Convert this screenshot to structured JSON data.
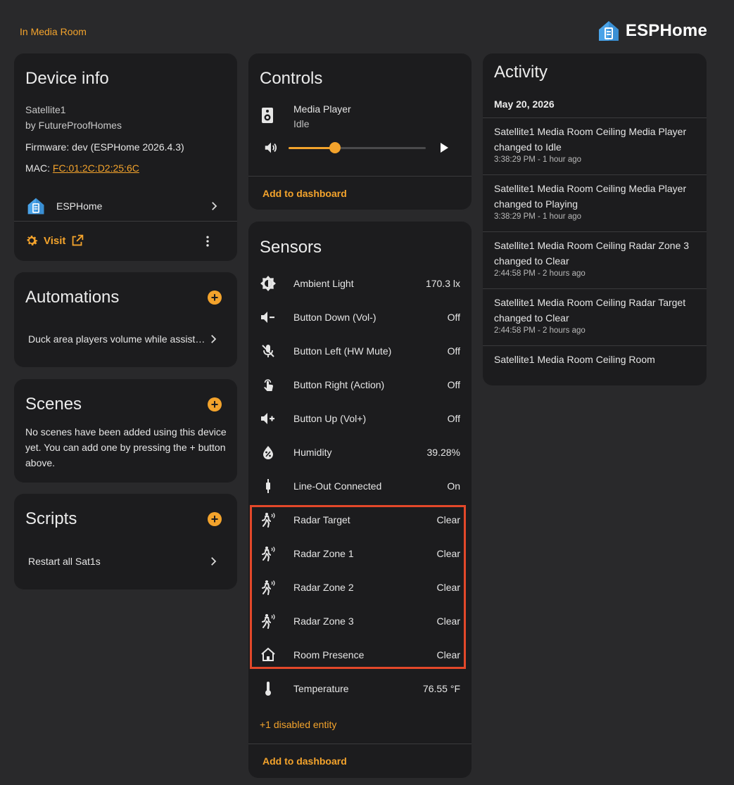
{
  "header": {
    "area_link": "In Media Room",
    "brand_name": "ESPHome"
  },
  "device_info": {
    "title": "Device info",
    "model": "Satellite1",
    "manufacturer": "by FutureProofHomes",
    "firmware": "Firmware: dev (ESPHome 2026.4.3)",
    "mac_label": "MAC: ",
    "mac_value": "FC:01:2C:D2:25:6C",
    "integration": "ESPHome",
    "visit_label": "Visit"
  },
  "automations": {
    "title": "Automations",
    "items": [
      "Duck area players volume while assist is active"
    ]
  },
  "scenes": {
    "title": "Scenes",
    "empty_text": "No scenes have been added using this device yet. You can add one by pressing the + button above."
  },
  "scripts": {
    "title": "Scripts",
    "items": [
      "Restart all Sat1s"
    ]
  },
  "controls": {
    "title": "Controls",
    "media_player": {
      "name": "Media Player",
      "state": "Idle",
      "volume": 0.34
    },
    "add_to_dashboard": "Add to dashboard"
  },
  "sensors": {
    "title": "Sensors",
    "items": [
      {
        "name": "Ambient Light",
        "value": "170.3 lx",
        "icon": "brightness-icon"
      },
      {
        "name": "Button Down (Vol-)",
        "value": "Off",
        "icon": "volume-minus-icon"
      },
      {
        "name": "Button Left (HW Mute)",
        "value": "Off",
        "icon": "mic-off-icon"
      },
      {
        "name": "Button Right (Action)",
        "value": "Off",
        "icon": "gesture-tap-icon"
      },
      {
        "name": "Button Up (Vol+)",
        "value": "Off",
        "icon": "volume-plus-icon"
      },
      {
        "name": "Humidity",
        "value": "39.28%",
        "icon": "water-percent-icon"
      },
      {
        "name": "Line-Out Connected",
        "value": "On",
        "icon": "audio-jack-icon"
      },
      {
        "name": "Radar Target",
        "value": "Clear",
        "icon": "motion-sensor-icon"
      },
      {
        "name": "Radar Zone 1",
        "value": "Clear",
        "icon": "motion-sensor-icon"
      },
      {
        "name": "Radar Zone 2",
        "value": "Clear",
        "icon": "motion-sensor-icon"
      },
      {
        "name": "Radar Zone 3",
        "value": "Clear",
        "icon": "motion-sensor-icon"
      },
      {
        "name": "Room Presence",
        "value": "Clear",
        "icon": "home-icon"
      },
      {
        "name": "Temperature",
        "value": "76.55 °F",
        "icon": "thermometer-icon"
      }
    ],
    "disabled_entities": "+1 disabled entity",
    "add_to_dashboard": "Add to dashboard"
  },
  "activity": {
    "title": "Activity",
    "date": "May 20, 2026",
    "entries": [
      {
        "message": "Satellite1 Media Room Ceiling Media Player changed to Idle",
        "time": "3:38:29 PM - 1 hour ago"
      },
      {
        "message": "Satellite1 Media Room Ceiling Media Player changed to Playing",
        "time": "3:38:29 PM - 1 hour ago"
      },
      {
        "message": "Satellite1 Media Room Ceiling Radar Zone 3 changed to Clear",
        "time": "2:44:58 PM - 2 hours ago"
      },
      {
        "message": "Satellite1 Media Room Ceiling Radar Target changed to Clear",
        "time": "2:44:58 PM - 2 hours ago"
      },
      {
        "message": "Satellite1 Media Room Ceiling Room",
        "time": ""
      }
    ]
  },
  "colors": {
    "accent": "#f3a32c",
    "background": "#29292b",
    "card": "#1c1c1e",
    "highlight": "#e3482a"
  }
}
